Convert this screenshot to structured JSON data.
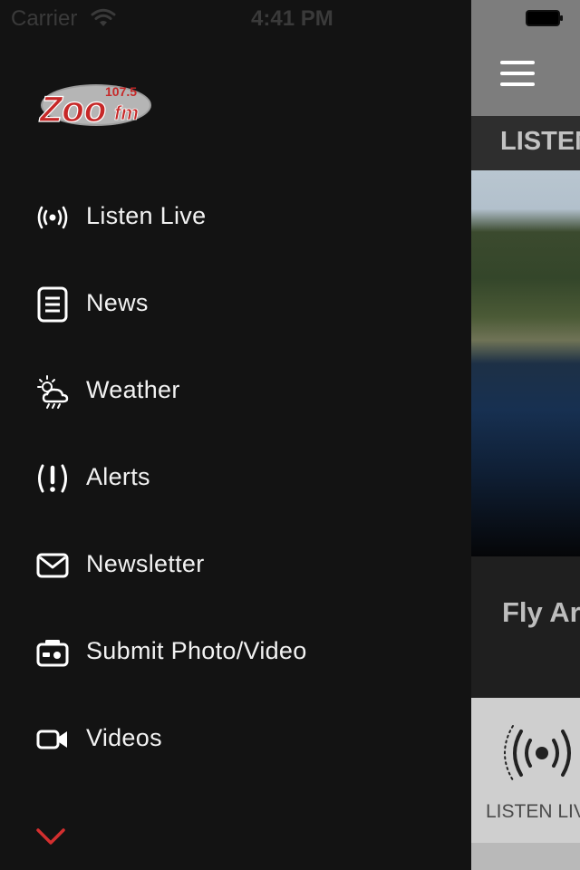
{
  "status_bar": {
    "carrier": "Carrier",
    "time": "4:41 PM"
  },
  "drawer": {
    "logo": {
      "text": "Zoo",
      "suffix": "fm",
      "frequency": "107.5",
      "icon": "zoo-fm-logo"
    },
    "menu": [
      {
        "label": "Listen Live",
        "icon": "broadcast-icon"
      },
      {
        "label": "News",
        "icon": "document-icon"
      },
      {
        "label": "Weather",
        "icon": "weather-icon"
      },
      {
        "label": "Alerts",
        "icon": "alert-icon"
      },
      {
        "label": "Newsletter",
        "icon": "mail-icon"
      },
      {
        "label": "Submit Photo/Video",
        "icon": "camera-icon"
      },
      {
        "label": "Videos",
        "icon": "video-camera-icon"
      }
    ],
    "more_icon": "chevron-down-icon",
    "accent_color": "#d32f2f"
  },
  "main": {
    "menu_icon": "hamburger-icon",
    "section_title": "LISTEN LIVE",
    "hero_headline": "Fly Around",
    "bottom_tab": {
      "label": "LISTEN LIVE",
      "icon": "broadcast-icon"
    }
  },
  "colors": {
    "drawer_background": "#131313",
    "nav_bar": "#7d7d7d",
    "logo_red": "#c62828"
  }
}
